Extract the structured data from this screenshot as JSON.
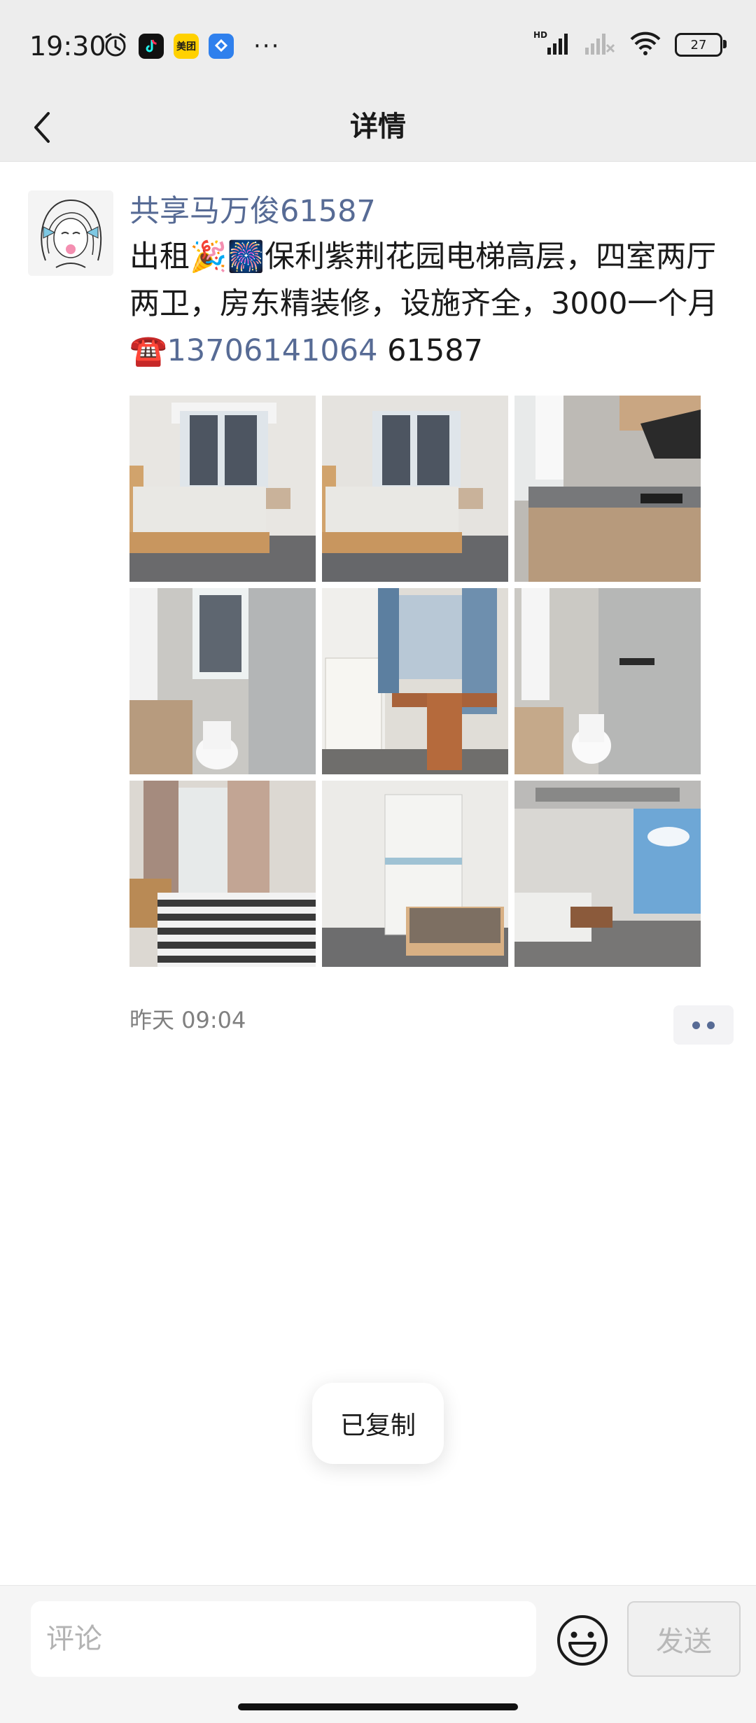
{
  "status_bar": {
    "time": "19:30",
    "notification_apps": [
      {
        "name": "alarm-icon"
      },
      {
        "name": "douyin-app-icon",
        "color": "#111111"
      },
      {
        "name": "meituan-app-icon",
        "label": "美团",
        "color": "#ffd100"
      },
      {
        "name": "app-icon-blue",
        "color": "#2f80ed"
      }
    ],
    "more": "···",
    "battery": "27",
    "signal_label": "HD"
  },
  "nav": {
    "title": "详情"
  },
  "post": {
    "username": "共享马万俊61587",
    "text_part1": "出租🎉🎆保利紫荆花园电梯高层，四室两厅两卫，房东精装修，设施齐全，3000一个月☎️",
    "phone": "13706141064",
    "text_part2": "  61587",
    "photos": [
      {
        "name": "bedroom-photo"
      },
      {
        "name": "bedroom-photo"
      },
      {
        "name": "kitchen-photo"
      },
      {
        "name": "bathroom-photo"
      },
      {
        "name": "study-room-photo"
      },
      {
        "name": "bathroom-photo"
      },
      {
        "name": "bedroom-photo"
      },
      {
        "name": "bedroom-photo"
      },
      {
        "name": "living-room-photo"
      }
    ],
    "timestamp": "昨天 09:04"
  },
  "toast": {
    "text": "已复制"
  },
  "comment_bar": {
    "placeholder": "评论",
    "send_label": "发送"
  },
  "colors": {
    "link": "#576b95",
    "header_bg": "#ededed"
  }
}
